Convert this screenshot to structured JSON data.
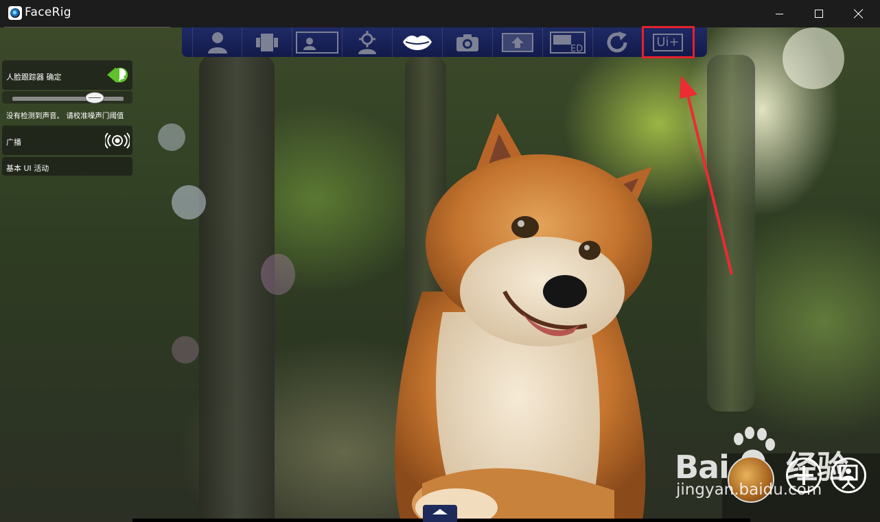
{
  "window": {
    "title": "FaceRig",
    "controls": [
      "minimize",
      "maximize",
      "close"
    ]
  },
  "toolbar": {
    "buttons": [
      {
        "icon": "avatar-person-icon"
      },
      {
        "icon": "scene-background-icon"
      },
      {
        "icon": "webcam-preview-icon"
      },
      {
        "icon": "calibrate-icon"
      },
      {
        "icon": "lips-audio-icon"
      },
      {
        "icon": "camera-snapshot-icon"
      },
      {
        "icon": "record-video-icon"
      },
      {
        "icon": "broadcast-ed-icon",
        "label": "ED"
      },
      {
        "icon": "reset-refresh-icon"
      },
      {
        "icon": "ui-plus-icon",
        "label": "Ui+",
        "highlighted": true
      }
    ]
  },
  "left_panel": {
    "face_tracker_label": "人脸跟踪器 确定",
    "audio_warning": "没有检测到声音。 请校准噪声门阈值",
    "broadcast_label": "广播",
    "basic_ui_label": "基本 UI 活动"
  },
  "watermark": {
    "brand": "Bai",
    "brand_suffix": "经验",
    "url": "jingyan.baidu.com"
  },
  "colors": {
    "toolbar": "#1b255c",
    "highlight": "#e8212b",
    "toggle_green": "#5ec22a"
  }
}
